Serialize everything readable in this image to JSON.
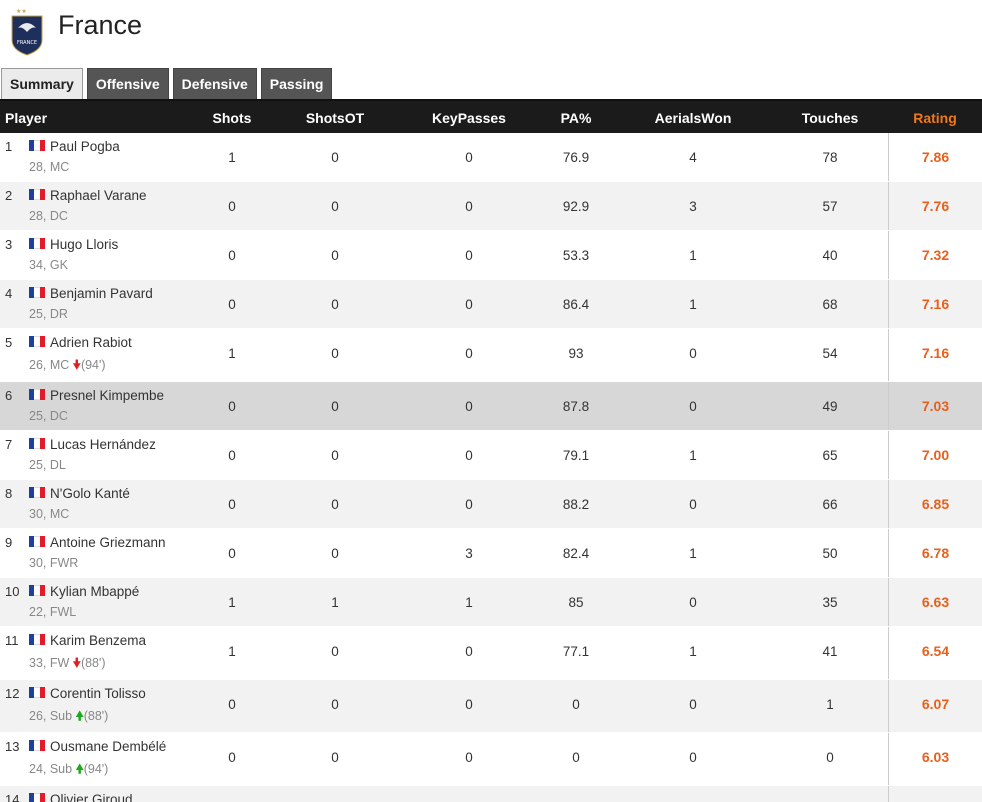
{
  "team": {
    "name": "France",
    "crest_text": "FRANCE"
  },
  "tabs": [
    {
      "label": "Summary",
      "active": true
    },
    {
      "label": "Offensive",
      "active": false
    },
    {
      "label": "Defensive",
      "active": false
    },
    {
      "label": "Passing",
      "active": false
    }
  ],
  "columns": {
    "player": "Player",
    "shots": "Shots",
    "shots_ot": "ShotsOT",
    "key_passes": "KeyPasses",
    "pa": "PA%",
    "aerials_won": "AerialsWon",
    "touches": "Touches",
    "rating": "Rating"
  },
  "colors": {
    "rating": "#e8601c",
    "header_bg": "#1b1b1b",
    "flag_blue": "#1e3f9e",
    "flag_red": "#e21b2b"
  },
  "players": [
    {
      "rank": "1",
      "name": "Paul Pogba",
      "meta": "28, MC",
      "sub": "",
      "sub_dir": "",
      "shots": "1",
      "shots_ot": "0",
      "key_passes": "0",
      "pa": "76.9",
      "aerials_won": "4",
      "touches": "78",
      "rating": "7.86"
    },
    {
      "rank": "2",
      "name": "Raphael Varane",
      "meta": "28, DC",
      "sub": "",
      "sub_dir": "",
      "shots": "0",
      "shots_ot": "0",
      "key_passes": "0",
      "pa": "92.9",
      "aerials_won": "3",
      "touches": "57",
      "rating": "7.76"
    },
    {
      "rank": "3",
      "name": "Hugo Lloris",
      "meta": "34, GK",
      "sub": "",
      "sub_dir": "",
      "shots": "0",
      "shots_ot": "0",
      "key_passes": "0",
      "pa": "53.3",
      "aerials_won": "1",
      "touches": "40",
      "rating": "7.32"
    },
    {
      "rank": "4",
      "name": "Benjamin Pavard",
      "meta": "25, DR",
      "sub": "",
      "sub_dir": "",
      "shots": "0",
      "shots_ot": "0",
      "key_passes": "0",
      "pa": "86.4",
      "aerials_won": "1",
      "touches": "68",
      "rating": "7.16"
    },
    {
      "rank": "5",
      "name": "Adrien Rabiot",
      "meta": "26, MC",
      "sub": "(94')",
      "sub_dir": "down",
      "shots": "1",
      "shots_ot": "0",
      "key_passes": "0",
      "pa": "93",
      "aerials_won": "0",
      "touches": "54",
      "rating": "7.16"
    },
    {
      "rank": "6",
      "name": "Presnel Kimpembe",
      "meta": "25, DC",
      "sub": "",
      "sub_dir": "",
      "shots": "0",
      "shots_ot": "0",
      "key_passes": "0",
      "pa": "87.8",
      "aerials_won": "0",
      "touches": "49",
      "rating": "7.03"
    },
    {
      "rank": "7",
      "name": "Lucas Hernández",
      "meta": "25, DL",
      "sub": "",
      "sub_dir": "",
      "shots": "0",
      "shots_ot": "0",
      "key_passes": "0",
      "pa": "79.1",
      "aerials_won": "1",
      "touches": "65",
      "rating": "7.00"
    },
    {
      "rank": "8",
      "name": "N'Golo Kanté",
      "meta": "30, MC",
      "sub": "",
      "sub_dir": "",
      "shots": "0",
      "shots_ot": "0",
      "key_passes": "0",
      "pa": "88.2",
      "aerials_won": "0",
      "touches": "66",
      "rating": "6.85"
    },
    {
      "rank": "9",
      "name": "Antoine Griezmann",
      "meta": "30, FWR",
      "sub": "",
      "sub_dir": "",
      "shots": "0",
      "shots_ot": "0",
      "key_passes": "3",
      "pa": "82.4",
      "aerials_won": "1",
      "touches": "50",
      "rating": "6.78"
    },
    {
      "rank": "10",
      "name": "Kylian Mbappé",
      "meta": "22, FWL",
      "sub": "",
      "sub_dir": "",
      "shots": "1",
      "shots_ot": "1",
      "key_passes": "1",
      "pa": "85",
      "aerials_won": "0",
      "touches": "35",
      "rating": "6.63"
    },
    {
      "rank": "11",
      "name": "Karim Benzema",
      "meta": "33, FW",
      "sub": "(88')",
      "sub_dir": "down",
      "shots": "1",
      "shots_ot": "0",
      "key_passes": "0",
      "pa": "77.1",
      "aerials_won": "1",
      "touches": "41",
      "rating": "6.54"
    },
    {
      "rank": "12",
      "name": "Corentin Tolisso",
      "meta": "26, Sub",
      "sub": "(88')",
      "sub_dir": "up",
      "shots": "0",
      "shots_ot": "0",
      "key_passes": "0",
      "pa": "0",
      "aerials_won": "0",
      "touches": "1",
      "rating": "6.07"
    },
    {
      "rank": "13",
      "name": "Ousmane Dembélé",
      "meta": "24, Sub",
      "sub": "(94')",
      "sub_dir": "up",
      "shots": "0",
      "shots_ot": "0",
      "key_passes": "0",
      "pa": "0",
      "aerials_won": "0",
      "touches": "0",
      "rating": "6.03"
    },
    {
      "rank": "14",
      "name": "Olivier Giroud",
      "meta": "",
      "sub": "",
      "sub_dir": "",
      "shots": "",
      "shots_ot": "",
      "key_passes": "",
      "pa": "",
      "aerials_won": "",
      "touches": "",
      "rating": ""
    }
  ]
}
